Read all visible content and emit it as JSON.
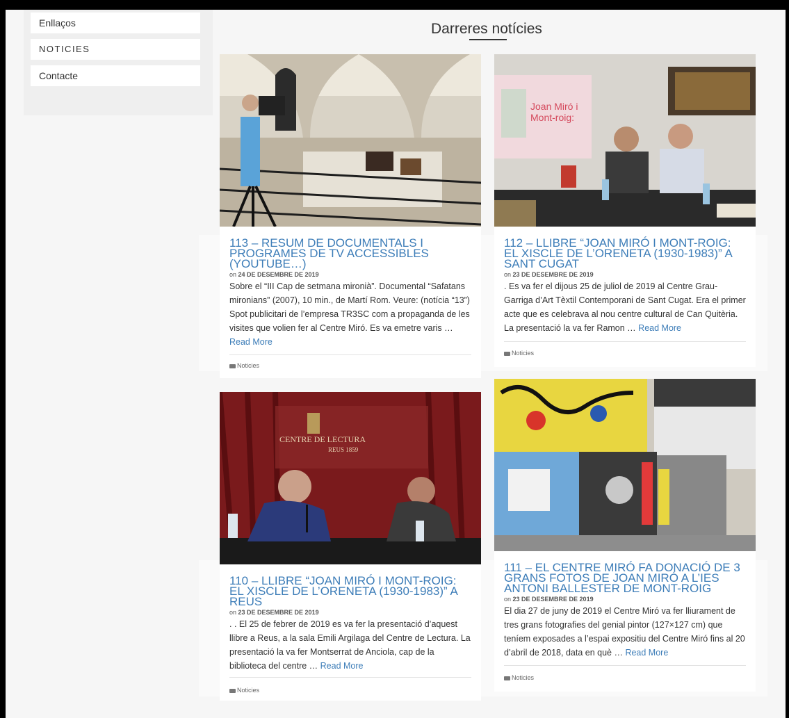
{
  "sidebar": {
    "items": [
      {
        "label": "Enllaços"
      },
      {
        "label": "NOTICIES"
      },
      {
        "label": "Contacte"
      }
    ]
  },
  "main": {
    "heading": "Darreres notícies",
    "read_more": "Read More",
    "date_prefix": "on",
    "posts": [
      {
        "title": "113 – RESUM DE DOCUMENTALS I PROGRAMES DE TV ACCESSIBLES (YOUTUBE…)",
        "date": "24 DE DESEMBRE DE 2019",
        "excerpt": "Sobre el “III Cap de setmana mironià”. Documental “Safatans mironians” (2007), 10 min., de Martí Rom. Veure: (notícia “13”) Spot publicitari de l’empresa TR3SC com a propaganda de les visites que volien fer al Centre Miró. Es va emetre varis …",
        "category": "Noticies"
      },
      {
        "title": "112 – LLIBRE “JOAN MIRÓ I MONT-ROIG: EL XISCLE DE L’ORENETA (1930-1983)” A SANT CUGAT",
        "date": "23 DE DESEMBRE DE 2019",
        "excerpt": ". Es va fer el dijous 25 de juliol de 2019 al Centre Grau-Garriga d’Art Tèxtil Contemporani de Sant Cugat. Era el primer acte que es celebrava al nou centre cultural de Can Quitèria. La presentació la va fer Ramon …",
        "category": "Noticies"
      },
      {
        "title": "110 – LLIBRE “JOAN MIRÓ I MONT-ROIG: EL XISCLE DE L’ORENETA (1930-1983)” A REUS",
        "date": "23 DE DESEMBRE DE 2019",
        "excerpt": ". . El 25 de febrer de 2019 es va fer la presentació d’aquest llibre a Reus, a la sala Emili Argilaga del Centre de Lectura. La presentació la va fer Montserrat de Anciola, cap de la biblioteca del centre …",
        "category": "Noticies"
      },
      {
        "title": "111 – EL CENTRE MIRÓ FA DONACIÓ DE 3 GRANS FOTOS DE JOAN MIRÓ A L’IES ANTONI BALLESTER DE MONT-ROIG",
        "date": "23 DE DESEMBRE DE 2019",
        "excerpt": "El dia 27 de juny de 2019 el Centre Miró va fer lliurament de tres grans fotografies del genial pintor (127×127 cm)  que teníem exposades a l’espai expositiu del Centre Miró fins al 20 d’abril de 2018, data en què …",
        "category": "Noticies"
      }
    ]
  }
}
